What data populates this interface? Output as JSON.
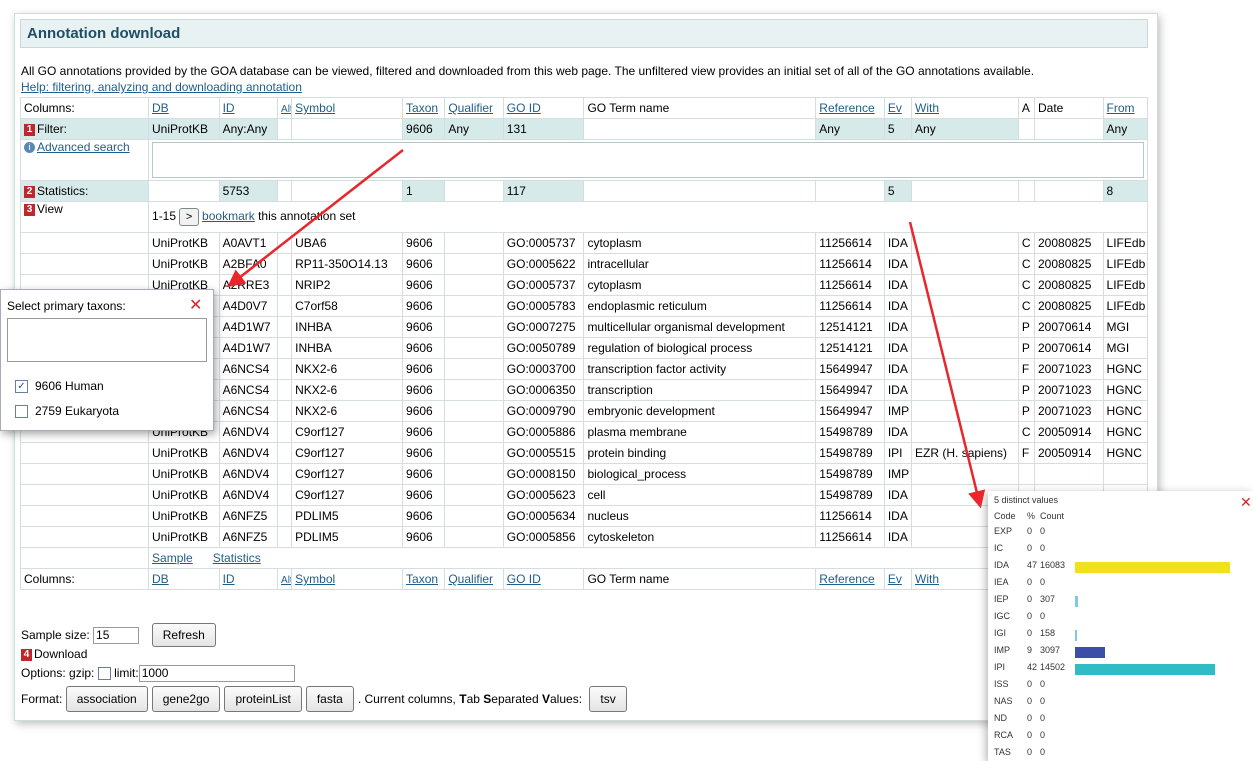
{
  "title": "Annotation download",
  "intro": "All GO annotations provided by the GOA database can be viewed, filtered and downloaded from this web page. The unfiltered view provides an initial set of all of the GO annotations available.",
  "help_link": "Help: filtering, analyzing and downloading annotation",
  "columns_label": "Columns:",
  "col_headers": {
    "db": "DB",
    "id": "ID",
    "alt": "Alt",
    "symbol": "Symbol",
    "taxon": "Taxon",
    "qualifier": "Qualifier",
    "goid": "GO ID",
    "goterm": "GO Term name",
    "reference": "Reference",
    "ev": "Ev",
    "with": "With",
    "a": "A",
    "date": "Date",
    "from": "From"
  },
  "filter": {
    "num": "1",
    "label": "Filter:",
    "db": "UniProtKB",
    "id": "Any:Any",
    "taxon": "9606",
    "qualifier": "Any",
    "goid": "131",
    "reference": "Any",
    "ev": "5",
    "with": "Any",
    "from": "Any"
  },
  "advanced_search": "Advanced search",
  "statistics": {
    "num": "2",
    "label": "Statistics:",
    "id": "5753",
    "taxon": "1",
    "goid": "117",
    "ev": "5",
    "from": "8"
  },
  "view": {
    "num": "3",
    "label": "View",
    "range": "1-15",
    "next": ">",
    "bookmark": "bookmark",
    "bookmark_suffix": " this annotation set"
  },
  "rows": [
    {
      "db": "UniProtKB",
      "id": "A0AVT1",
      "symbol": "UBA6",
      "taxon": "9606",
      "goid": "GO:0005737",
      "term": "cytoplasm",
      "ref": "11256614",
      "ev": "IDA",
      "with": "",
      "a": "C",
      "date": "20080825",
      "from": "LIFEdb"
    },
    {
      "db": "UniProtKB",
      "id": "A2BFA0",
      "symbol": "RP11-350O14.13",
      "taxon": "9606",
      "goid": "GO:0005622",
      "term": "intracellular",
      "ref": "11256614",
      "ev": "IDA",
      "with": "",
      "a": "C",
      "date": "20080825",
      "from": "LIFEdb"
    },
    {
      "db": "UniProtKB",
      "id": "A2RRE3",
      "symbol": "NRIP2",
      "taxon": "9606",
      "goid": "GO:0005737",
      "term": "cytoplasm",
      "ref": "11256614",
      "ev": "IDA",
      "with": "",
      "a": "C",
      "date": "20080825",
      "from": "LIFEdb"
    },
    {
      "db": "UniProtKB",
      "id": "A4D0V7",
      "symbol": "C7orf58",
      "taxon": "9606",
      "goid": "GO:0005783",
      "term": "endoplasmic reticulum",
      "ref": "11256614",
      "ev": "IDA",
      "with": "",
      "a": "C",
      "date": "20080825",
      "from": "LIFEdb"
    },
    {
      "db": "UniProtKB",
      "id": "A4D1W7",
      "symbol": "INHBA",
      "taxon": "9606",
      "goid": "GO:0007275",
      "term": "multicellular organismal development",
      "ref": "12514121",
      "ev": "IDA",
      "with": "",
      "a": "P",
      "date": "20070614",
      "from": "MGI"
    },
    {
      "db": "UniProtKB",
      "id": "A4D1W7",
      "symbol": "INHBA",
      "taxon": "9606",
      "goid": "GO:0050789",
      "term": "regulation of biological process",
      "ref": "12514121",
      "ev": "IDA",
      "with": "",
      "a": "P",
      "date": "20070614",
      "from": "MGI"
    },
    {
      "db": "UniProtKB",
      "id": "A6NCS4",
      "symbol": "NKX2-6",
      "taxon": "9606",
      "goid": "GO:0003700",
      "term": "transcription factor activity",
      "ref": "15649947",
      "ev": "IDA",
      "with": "",
      "a": "F",
      "date": "20071023",
      "from": "HGNC"
    },
    {
      "db": "UniProtKB",
      "id": "A6NCS4",
      "symbol": "NKX2-6",
      "taxon": "9606",
      "goid": "GO:0006350",
      "term": "transcription",
      "ref": "15649947",
      "ev": "IDA",
      "with": "",
      "a": "P",
      "date": "20071023",
      "from": "HGNC"
    },
    {
      "db": "UniProtKB",
      "id": "A6NCS4",
      "symbol": "NKX2-6",
      "taxon": "9606",
      "goid": "GO:0009790",
      "term": "embryonic development",
      "ref": "15649947",
      "ev": "IMP",
      "with": "",
      "a": "P",
      "date": "20071023",
      "from": "HGNC"
    },
    {
      "db": "UniProtKB",
      "id": "A6NDV4",
      "symbol": "C9orf127",
      "taxon": "9606",
      "goid": "GO:0005886",
      "term": "plasma membrane",
      "ref": "15498789",
      "ev": "IDA",
      "with": "",
      "a": "C",
      "date": "20050914",
      "from": "HGNC"
    },
    {
      "db": "UniProtKB",
      "id": "A6NDV4",
      "symbol": "C9orf127",
      "taxon": "9606",
      "goid": "GO:0005515",
      "term": "protein binding",
      "ref": "15498789",
      "ev": "IPI",
      "with": "EZR (H. sapiens)",
      "a": "F",
      "date": "20050914",
      "from": "HGNC"
    },
    {
      "db": "UniProtKB",
      "id": "A6NDV4",
      "symbol": "C9orf127",
      "taxon": "9606",
      "goid": "GO:0008150",
      "term": "biological_process",
      "ref": "15498789",
      "ev": "IMP",
      "with": "",
      "a": "",
      "date": "",
      "from": ""
    },
    {
      "db": "UniProtKB",
      "id": "A6NDV4",
      "symbol": "C9orf127",
      "taxon": "9606",
      "goid": "GO:0005623",
      "term": "cell",
      "ref": "15498789",
      "ev": "IDA",
      "with": "",
      "a": "",
      "date": "",
      "from": ""
    },
    {
      "db": "UniProtKB",
      "id": "A6NFZ5",
      "symbol": "PDLIM5",
      "taxon": "9606",
      "goid": "GO:0005634",
      "term": "nucleus",
      "ref": "11256614",
      "ev": "IDA",
      "with": "",
      "a": "",
      "date": "",
      "from": ""
    },
    {
      "db": "UniProtKB",
      "id": "A6NFZ5",
      "symbol": "PDLIM5",
      "taxon": "9606",
      "goid": "GO:0005856",
      "term": "cytoskeleton",
      "ref": "11256614",
      "ev": "IDA",
      "with": "",
      "a": "",
      "date": "",
      "from": ""
    }
  ],
  "footer_links": {
    "sample": "Sample",
    "statistics": "Statistics"
  },
  "sample_size_label": "Sample size:",
  "sample_size": "15",
  "refresh": "Refresh",
  "download": {
    "num": "4",
    "label": "Download"
  },
  "options_label": "Options: gzip:",
  "limit_label": "limit:",
  "limit_value": "1000",
  "format_label": "Format:",
  "format_buttons": [
    "association",
    "gene2go",
    "proteinList",
    "fasta"
  ],
  "current_columns_pre": ". Current columns, ",
  "tab_sep": {
    "t": "T",
    "ab": "ab ",
    "s": "S",
    "eparated": "eparated ",
    "v": "V",
    "alues": "alues:"
  },
  "tsv": "tsv",
  "taxon_popup": {
    "title": "Select primary taxons:",
    "close": "✕",
    "options": [
      {
        "label": "9606 Human",
        "checked": true
      },
      {
        "label": "2759 Eukaryota",
        "checked": false
      }
    ]
  },
  "stats_popup": {
    "close": "✕",
    "heading": "5 distinct values",
    "cols": {
      "code": "Code",
      "pct": "%",
      "count": "Count"
    },
    "rows": [
      {
        "code": "EXP",
        "pct": "0",
        "count": "0",
        "frac": 0,
        "color": ""
      },
      {
        "code": "IC",
        "pct": "0",
        "count": "0",
        "frac": 0,
        "color": ""
      },
      {
        "code": "IDA",
        "pct": "47",
        "count": "16083",
        "frac": 1.0,
        "color": "#f2e01c"
      },
      {
        "code": "IEA",
        "pct": "0",
        "count": "0",
        "frac": 0,
        "color": ""
      },
      {
        "code": "IEP",
        "pct": "0",
        "count": "307",
        "frac": 0.019,
        "color": "#7fc8e6"
      },
      {
        "code": "IGC",
        "pct": "0",
        "count": "0",
        "frac": 0,
        "color": ""
      },
      {
        "code": "IGI",
        "pct": "0",
        "count": "158",
        "frac": 0.01,
        "color": "#7fc8e6"
      },
      {
        "code": "IMP",
        "pct": "9",
        "count": "3097",
        "frac": 0.193,
        "color": "#3a4fa6"
      },
      {
        "code": "IPI",
        "pct": "42",
        "count": "14502",
        "frac": 0.902,
        "color": "#2fbcc4"
      },
      {
        "code": "ISS",
        "pct": "0",
        "count": "0",
        "frac": 0,
        "color": ""
      },
      {
        "code": "NAS",
        "pct": "0",
        "count": "0",
        "frac": 0,
        "color": ""
      },
      {
        "code": "ND",
        "pct": "0",
        "count": "0",
        "frac": 0,
        "color": ""
      },
      {
        "code": "RCA",
        "pct": "0",
        "count": "0",
        "frac": 0,
        "color": ""
      },
      {
        "code": "TAS",
        "pct": "0",
        "count": "0",
        "frac": 0,
        "color": ""
      }
    ]
  },
  "colors": {
    "accent": "#1f5e8a",
    "label_bg": "#d6eaea",
    "num_badge": "#c0272d",
    "arrow": "#e8262b"
  }
}
